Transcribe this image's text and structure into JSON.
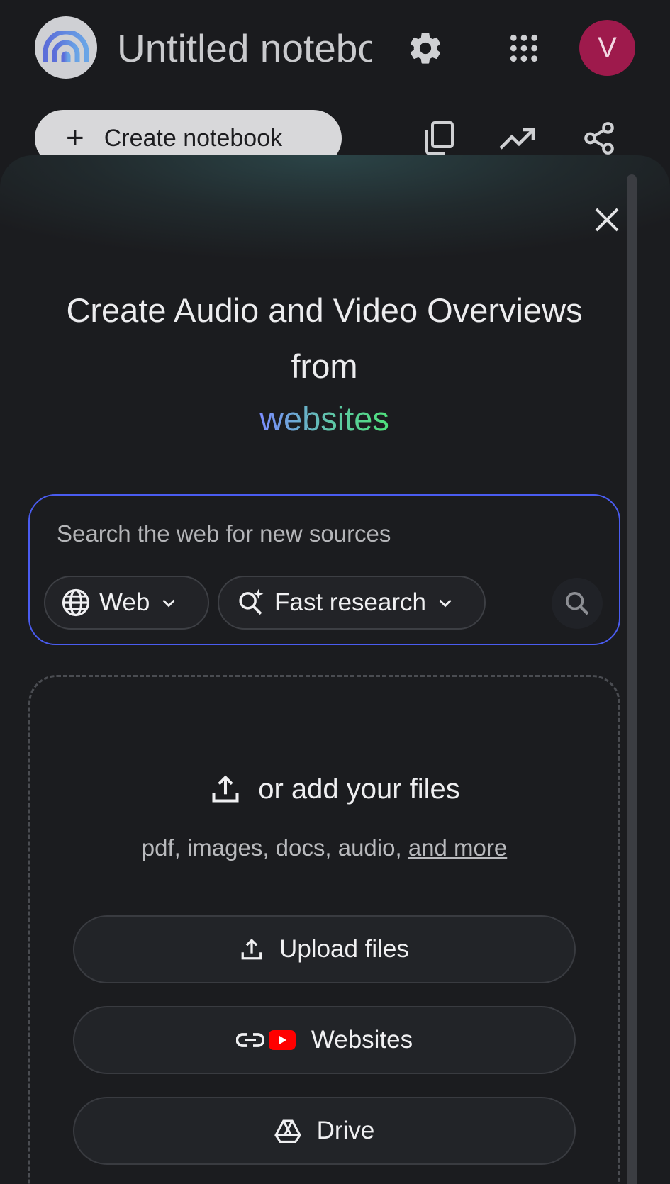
{
  "header": {
    "title": "Untitled notebook",
    "avatar_letter": "V",
    "avatar_color": "#9e1a4c",
    "create_label": "Create notebook",
    "icons": [
      "notebooklm-logo",
      "settings-icon",
      "apps-grid-icon",
      "copy-icon",
      "trending-icon",
      "share-icon"
    ]
  },
  "sheet": {
    "headline": "Create Audio and Video Overviews from",
    "highlight": "websites",
    "search": {
      "placeholder": "Search the web for new sources",
      "source_chip": "Web",
      "mode_chip": "Fast research"
    },
    "dropzone": {
      "title": "or add your files",
      "formats_prefix": "pdf, images, docs, audio, ",
      "formats_link": "and more",
      "buttons": {
        "upload": "Upload files",
        "websites": "Websites",
        "drive": "Drive"
      }
    }
  },
  "colors": {
    "accent_border": "#4a5cf0",
    "background": "#1a1b1e"
  }
}
